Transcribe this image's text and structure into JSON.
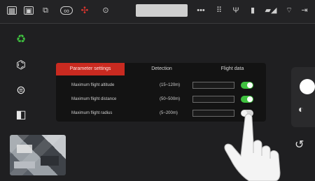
{
  "status_bar": {
    "placeholder_text": "",
    "text_labels": [
      "•••",
      "⠿",
      "",
      "",
      "",
      "",
      ""
    ]
  },
  "settings_panel": {
    "tabs": [
      {
        "label": "Parameter settings",
        "active": true
      },
      {
        "label": "Detection",
        "active": false
      },
      {
        "label": "Flight data",
        "active": false
      }
    ],
    "rows": [
      {
        "label": "Maximum flight altitude",
        "range": "(15~120m)",
        "value": "",
        "enabled": true
      },
      {
        "label": "Maximum flight distance",
        "range": "(50~500m)",
        "value": "",
        "enabled": true
      },
      {
        "label": "Maximum flight radius",
        "range": "(5~200m)",
        "value": "",
        "enabled": false
      }
    ]
  },
  "colors": {
    "accent_red": "#c92a20",
    "toggle_green": "#3fc13f",
    "background": "#1f1f21"
  },
  "icons": {
    "left_sidebar": [
      "recycle-icon",
      "drone-icon",
      "camera-lens-icon",
      "cube-icon"
    ],
    "right_panel": [
      "shutter-button",
      "camera-switch-icon",
      "gimbal-icon"
    ]
  }
}
